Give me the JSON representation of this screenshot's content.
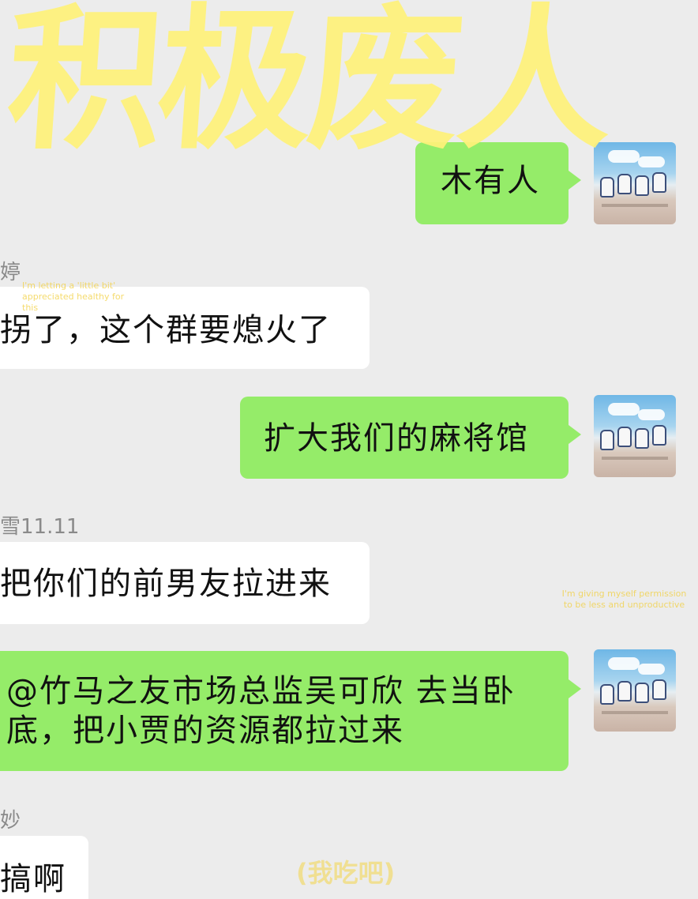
{
  "overlay": {
    "title": "积极废人",
    "watermark_left": "I'm letting a 'little bit' appreciated healthy for this",
    "watermark_right": "I'm giving myself permission to be less and unproductive",
    "watermark_bottom": "(我吃吧)"
  },
  "messages": [
    {
      "side": "out",
      "sender": "",
      "text": "木有人"
    },
    {
      "side": "in",
      "sender": "婷",
      "text": "拐了，这个群要熄火了"
    },
    {
      "side": "out",
      "sender": "",
      "text": "扩大我们的麻将馆"
    },
    {
      "side": "in",
      "sender": "雪11.11",
      "text": "把你们的前男友拉进来"
    },
    {
      "side": "out",
      "sender": "",
      "line1": "@竹马之友市场总监吴可欣  去当卧",
      "line2": "底，把小贾的资源都拉过来"
    },
    {
      "side": "in",
      "sender": "妙",
      "text": "搞啊"
    }
  ],
  "top_partial": "...",
  "colors": {
    "background": "#ececec",
    "incoming_bubble": "#ffffff",
    "outgoing_bubble": "#95ec69",
    "overlay_title": "#fff27a"
  }
}
